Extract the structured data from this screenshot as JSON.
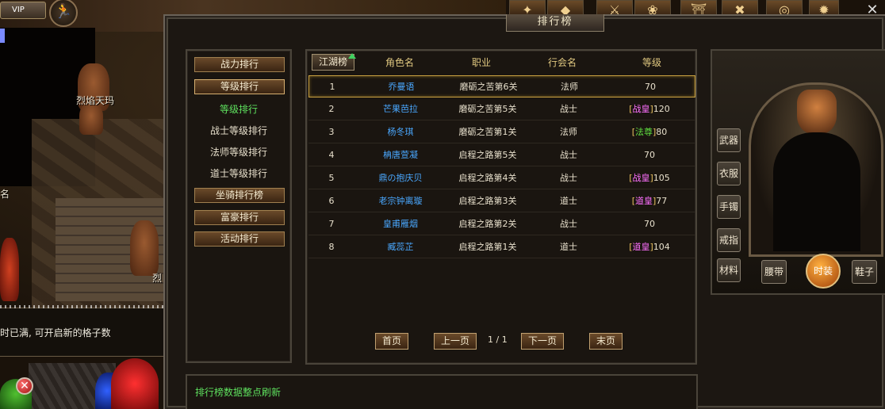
{
  "hud": {
    "vip_label": "VIP",
    "map_label_1": "烈焰天玛",
    "map_label_2": "名",
    "map_label_3": "烈",
    "tooltip_text": "时已满, 可开启新的格子数"
  },
  "window": {
    "title": "排行榜",
    "categories": {
      "combat": "战力排行",
      "level": "等级排行",
      "level_sub": [
        "等级排行",
        "战士等级排行",
        "法师等级排行",
        "道士等级排行"
      ],
      "mount": "坐骑排行榜",
      "wealth": "富豪排行",
      "activity": "活动排行"
    },
    "table": {
      "tab_label": "江湖榜",
      "headers": {
        "name": "角色名",
        "job": "职业",
        "guild": "行会名",
        "level": "等级"
      },
      "rows": [
        {
          "rank": "1",
          "name": "乔曼语",
          "stage": "磨砺之苦第6关",
          "job": "法师",
          "tag": "",
          "level": "70"
        },
        {
          "rank": "2",
          "name": "芒果芭拉",
          "stage": "磨砺之苦第5关",
          "job": "战士",
          "tag": "战皇",
          "level": "120"
        },
        {
          "rank": "3",
          "name": "杨冬琪",
          "stage": "磨砺之苦第1关",
          "job": "法师",
          "tag": "法尊",
          "level": "80"
        },
        {
          "rank": "4",
          "name": "柟唐萱凝",
          "stage": "启程之路第5关",
          "job": "战士",
          "tag": "",
          "level": "70"
        },
        {
          "rank": "5",
          "name": "鼎の抱庆贝",
          "stage": "启程之路第4关",
          "job": "战士",
          "tag": "战皇",
          "level": "105"
        },
        {
          "rank": "6",
          "name": "老宗钟离璇",
          "stage": "启程之路第3关",
          "job": "道士",
          "tag": "道皇",
          "level": "77"
        },
        {
          "rank": "7",
          "name": "皇甫雁烟",
          "stage": "启程之路第2关",
          "job": "战士",
          "tag": "",
          "level": "70"
        },
        {
          "rank": "8",
          "name": "臧蕊芷",
          "stage": "启程之路第1关",
          "job": "道士",
          "tag": "道皇",
          "level": "104"
        }
      ]
    },
    "pager": {
      "first": "首页",
      "prev": "上一页",
      "page": "1 / 1",
      "next": "下一页",
      "last": "末页"
    },
    "notice": "排行榜数据整点刷新",
    "equipment": {
      "weapon": "武器",
      "clothes": "衣服",
      "bracelet": "手镯",
      "ring": "戒指",
      "material": "材料",
      "belt": "腰带",
      "fashion": "时装",
      "shoes": "鞋子"
    }
  },
  "colors": {
    "name_blue": "#4aa8ff",
    "green_text": "#5ee05e",
    "title_tag_purple": "#ff70ff",
    "highlight_gold": "#c8a040"
  }
}
